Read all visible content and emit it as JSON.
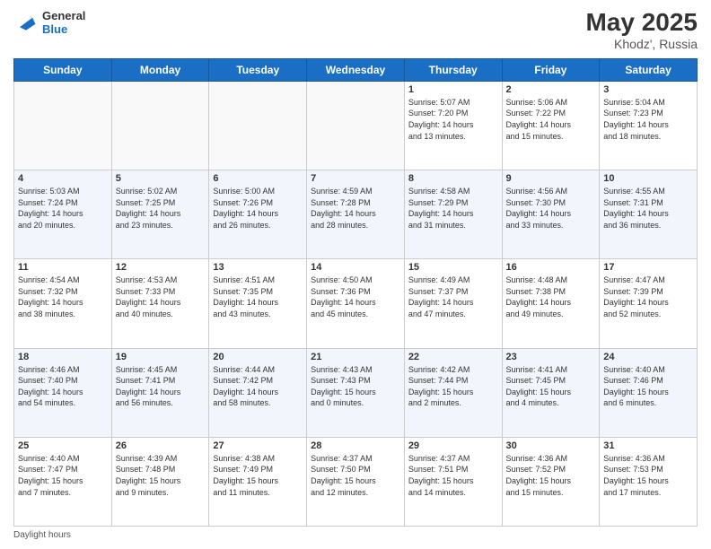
{
  "header": {
    "logo_general": "General",
    "logo_blue": "Blue",
    "title": "May 2025",
    "location": "Khodz', Russia"
  },
  "weekdays": [
    "Sunday",
    "Monday",
    "Tuesday",
    "Wednesday",
    "Thursday",
    "Friday",
    "Saturday"
  ],
  "weeks": [
    [
      {
        "day": "",
        "info": ""
      },
      {
        "day": "",
        "info": ""
      },
      {
        "day": "",
        "info": ""
      },
      {
        "day": "",
        "info": ""
      },
      {
        "day": "1",
        "info": "Sunrise: 5:07 AM\nSunset: 7:20 PM\nDaylight: 14 hours\nand 13 minutes."
      },
      {
        "day": "2",
        "info": "Sunrise: 5:06 AM\nSunset: 7:22 PM\nDaylight: 14 hours\nand 15 minutes."
      },
      {
        "day": "3",
        "info": "Sunrise: 5:04 AM\nSunset: 7:23 PM\nDaylight: 14 hours\nand 18 minutes."
      }
    ],
    [
      {
        "day": "4",
        "info": "Sunrise: 5:03 AM\nSunset: 7:24 PM\nDaylight: 14 hours\nand 20 minutes."
      },
      {
        "day": "5",
        "info": "Sunrise: 5:02 AM\nSunset: 7:25 PM\nDaylight: 14 hours\nand 23 minutes."
      },
      {
        "day": "6",
        "info": "Sunrise: 5:00 AM\nSunset: 7:26 PM\nDaylight: 14 hours\nand 26 minutes."
      },
      {
        "day": "7",
        "info": "Sunrise: 4:59 AM\nSunset: 7:28 PM\nDaylight: 14 hours\nand 28 minutes."
      },
      {
        "day": "8",
        "info": "Sunrise: 4:58 AM\nSunset: 7:29 PM\nDaylight: 14 hours\nand 31 minutes."
      },
      {
        "day": "9",
        "info": "Sunrise: 4:56 AM\nSunset: 7:30 PM\nDaylight: 14 hours\nand 33 minutes."
      },
      {
        "day": "10",
        "info": "Sunrise: 4:55 AM\nSunset: 7:31 PM\nDaylight: 14 hours\nand 36 minutes."
      }
    ],
    [
      {
        "day": "11",
        "info": "Sunrise: 4:54 AM\nSunset: 7:32 PM\nDaylight: 14 hours\nand 38 minutes."
      },
      {
        "day": "12",
        "info": "Sunrise: 4:53 AM\nSunset: 7:33 PM\nDaylight: 14 hours\nand 40 minutes."
      },
      {
        "day": "13",
        "info": "Sunrise: 4:51 AM\nSunset: 7:35 PM\nDaylight: 14 hours\nand 43 minutes."
      },
      {
        "day": "14",
        "info": "Sunrise: 4:50 AM\nSunset: 7:36 PM\nDaylight: 14 hours\nand 45 minutes."
      },
      {
        "day": "15",
        "info": "Sunrise: 4:49 AM\nSunset: 7:37 PM\nDaylight: 14 hours\nand 47 minutes."
      },
      {
        "day": "16",
        "info": "Sunrise: 4:48 AM\nSunset: 7:38 PM\nDaylight: 14 hours\nand 49 minutes."
      },
      {
        "day": "17",
        "info": "Sunrise: 4:47 AM\nSunset: 7:39 PM\nDaylight: 14 hours\nand 52 minutes."
      }
    ],
    [
      {
        "day": "18",
        "info": "Sunrise: 4:46 AM\nSunset: 7:40 PM\nDaylight: 14 hours\nand 54 minutes."
      },
      {
        "day": "19",
        "info": "Sunrise: 4:45 AM\nSunset: 7:41 PM\nDaylight: 14 hours\nand 56 minutes."
      },
      {
        "day": "20",
        "info": "Sunrise: 4:44 AM\nSunset: 7:42 PM\nDaylight: 14 hours\nand 58 minutes."
      },
      {
        "day": "21",
        "info": "Sunrise: 4:43 AM\nSunset: 7:43 PM\nDaylight: 15 hours\nand 0 minutes."
      },
      {
        "day": "22",
        "info": "Sunrise: 4:42 AM\nSunset: 7:44 PM\nDaylight: 15 hours\nand 2 minutes."
      },
      {
        "day": "23",
        "info": "Sunrise: 4:41 AM\nSunset: 7:45 PM\nDaylight: 15 hours\nand 4 minutes."
      },
      {
        "day": "24",
        "info": "Sunrise: 4:40 AM\nSunset: 7:46 PM\nDaylight: 15 hours\nand 6 minutes."
      }
    ],
    [
      {
        "day": "25",
        "info": "Sunrise: 4:40 AM\nSunset: 7:47 PM\nDaylight: 15 hours\nand 7 minutes."
      },
      {
        "day": "26",
        "info": "Sunrise: 4:39 AM\nSunset: 7:48 PM\nDaylight: 15 hours\nand 9 minutes."
      },
      {
        "day": "27",
        "info": "Sunrise: 4:38 AM\nSunset: 7:49 PM\nDaylight: 15 hours\nand 11 minutes."
      },
      {
        "day": "28",
        "info": "Sunrise: 4:37 AM\nSunset: 7:50 PM\nDaylight: 15 hours\nand 12 minutes."
      },
      {
        "day": "29",
        "info": "Sunrise: 4:37 AM\nSunset: 7:51 PM\nDaylight: 15 hours\nand 14 minutes."
      },
      {
        "day": "30",
        "info": "Sunrise: 4:36 AM\nSunset: 7:52 PM\nDaylight: 15 hours\nand 15 minutes."
      },
      {
        "day": "31",
        "info": "Sunrise: 4:36 AM\nSunset: 7:53 PM\nDaylight: 15 hours\nand 17 minutes."
      }
    ]
  ],
  "footer": "Daylight hours"
}
